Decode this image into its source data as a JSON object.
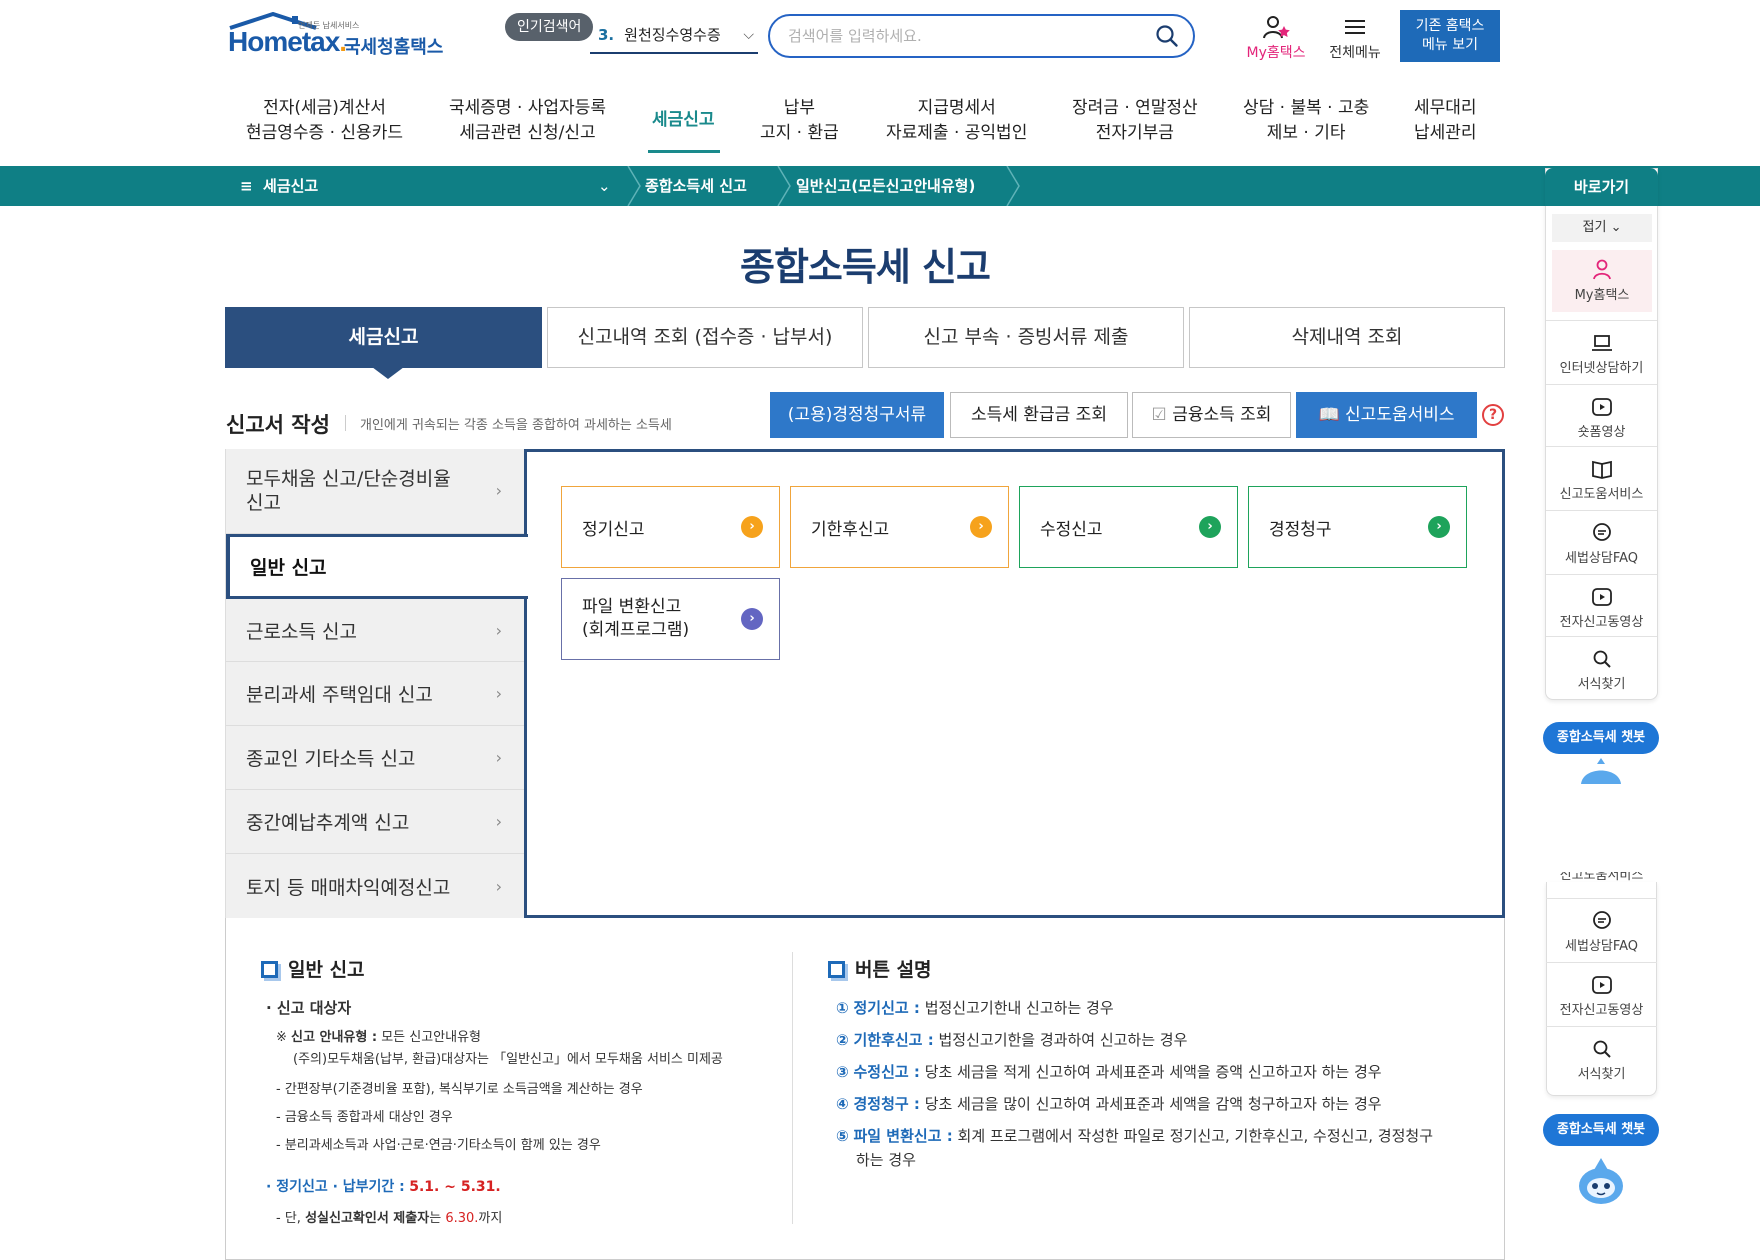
{
  "header": {
    "logo_tiny": "언제든 납세서비스",
    "logo_home": "Hom",
    "logo_e": "e",
    "logo_tax": "tax",
    "logo_kr": "국세청홈택스",
    "popular_tag": "인기검색어",
    "popular_num": "3.",
    "popular_term": "원천징수영수증",
    "search_placeholder": "검색어를 입력하세요.",
    "my_hometax": "My홈택스",
    "all_menu": "전체메뉴",
    "legacy_line1": "기존 홈택스",
    "legacy_line2": "메뉴 보기"
  },
  "gnb": [
    {
      "line1": "전자(세금)계산서",
      "line2": "현금영수증 · 신용카드"
    },
    {
      "line1": "국세증명 · 사업자등록",
      "line2": "세금관련 신청/신고"
    },
    {
      "line1": "세금신고",
      "line2": ""
    },
    {
      "line1": "납부",
      "line2": "고지 · 환급"
    },
    {
      "line1": "지급명세서",
      "line2": "자료제출 · 공익법인"
    },
    {
      "line1": "장려금 · 연말정산",
      "line2": "전자기부금"
    },
    {
      "line1": "상담 · 불복 · 고충",
      "line2": "제보 · 기타"
    },
    {
      "line1": "세무대리",
      "line2": "납세관리"
    }
  ],
  "breadcrumb": {
    "menu": "세금신고",
    "level2": "종합소득세 신고",
    "level3": "일반신고(모든신고안내유형)"
  },
  "page_title": "종합소득세 신고",
  "tabs": [
    "세금신고",
    "신고내역 조회 (접수증 · 납부서)",
    "신고 부속 · 증빙서류 제출",
    "삭제내역 조회"
  ],
  "section": {
    "title": "신고서 작성",
    "desc": "개인에게 귀속되는 각종 소득을 종합하여 과세하는 소득세"
  },
  "actions": [
    "(고용)경정청구서류",
    "소득세 환급금 조회",
    "금융소득 조회",
    "신고도움서비스"
  ],
  "help": "?",
  "left_menu": [
    {
      "line1": "모두채움 신고/단순경비율",
      "line2": "신고"
    },
    {
      "line1": "일반 신고",
      "line2": ""
    },
    {
      "line1": "근로소득 신고",
      "line2": ""
    },
    {
      "line1": "분리과세 주택임대 신고",
      "line2": ""
    },
    {
      "line1": "종교인 기타소득 신고",
      "line2": ""
    },
    {
      "line1": "중간예납추계액 신고",
      "line2": ""
    },
    {
      "line1": "토지 등 매매차익예정신고",
      "line2": ""
    }
  ],
  "sub_cards": [
    {
      "line1": "정기신고",
      "line2": ""
    },
    {
      "line1": "기한후신고",
      "line2": ""
    },
    {
      "line1": "수정신고",
      "line2": ""
    },
    {
      "line1": "경정청구",
      "line2": ""
    },
    {
      "line1": "파일 변환신고",
      "line2": "(회계프로그램)"
    }
  ],
  "info_left": {
    "heading": "일반 신고",
    "target_label": "· 신고 대상자",
    "guide_prefix": "※",
    "guide_label": "신고 안내유형 :",
    "guide_text": "모든 신고안내유형",
    "note": "(주의)모두채움(납부, 환급)대상자는 「일반신고」에서 모두채움 서비스 미제공",
    "items": [
      "- 간편장부(기준경비율 포함), 복식부기로 소득금액을 계산하는 경우",
      "- 금융소득 종합과세 대상인 경우",
      "- 분리과세소득과 사업·근로·연금·기타소득이 함께 있는 경우"
    ],
    "period_label": "· 정기신고 · 납부기간 :",
    "period_value": "5.1. ~ 5.31.",
    "period_note_prefix": "- 단,",
    "period_note_bold": "성실신고확인서 제출자",
    "period_note_mid": "는",
    "period_note_red": "6.30.",
    "period_note_suffix": "까지"
  },
  "info_right": {
    "heading": "버튼 설명",
    "items": [
      {
        "num": "①",
        "label": "정기신고 :",
        "text": "법정신고기한내 신고하는 경우",
        "text2": ""
      },
      {
        "num": "②",
        "label": "기한후신고 :",
        "text": "법정신고기한을 경과하여 신고하는 경우",
        "text2": ""
      },
      {
        "num": "③",
        "label": "수정신고 :",
        "text": "당초 세금을 적게 신고하여 과세표준과 세액을 증액 신고하고자 하는 경우",
        "text2": ""
      },
      {
        "num": "④",
        "label": "경정청구 :",
        "text": "당초 세금을 많이 신고하여 과세표준과 세액을 감액 청구하고자 하는 경우",
        "text2": ""
      },
      {
        "num": "⑤",
        "label": "파일 변환신고 :",
        "text": "회계 프로그램에서 작성한 파일로 정기신고, 기한후신고, 수정신고, 경정청구",
        "text2": "하는 경우"
      }
    ]
  },
  "quick": {
    "title": "바로가기",
    "fold": "접기",
    "my": "My홈택스",
    "items": [
      "인터넷상담하기",
      "숏폼영상",
      "신고도움서비스",
      "세법상담FAQ",
      "전자신고동영상",
      "서식찾기"
    ],
    "chatbot": "종합소득세 챗봇",
    "lower_items": [
      "세법상담FAQ",
      "전자신고동영상",
      "서식찾기"
    ],
    "lower_partial": "신고도움서비스"
  },
  "colors": {
    "navy": "#2b4f7f",
    "teal": "#0f7f85",
    "blue": "#1e6ab8",
    "orange": "#f6a21c",
    "green": "#1ea35b",
    "purple": "#6366c2",
    "pink": "#e3257a"
  }
}
